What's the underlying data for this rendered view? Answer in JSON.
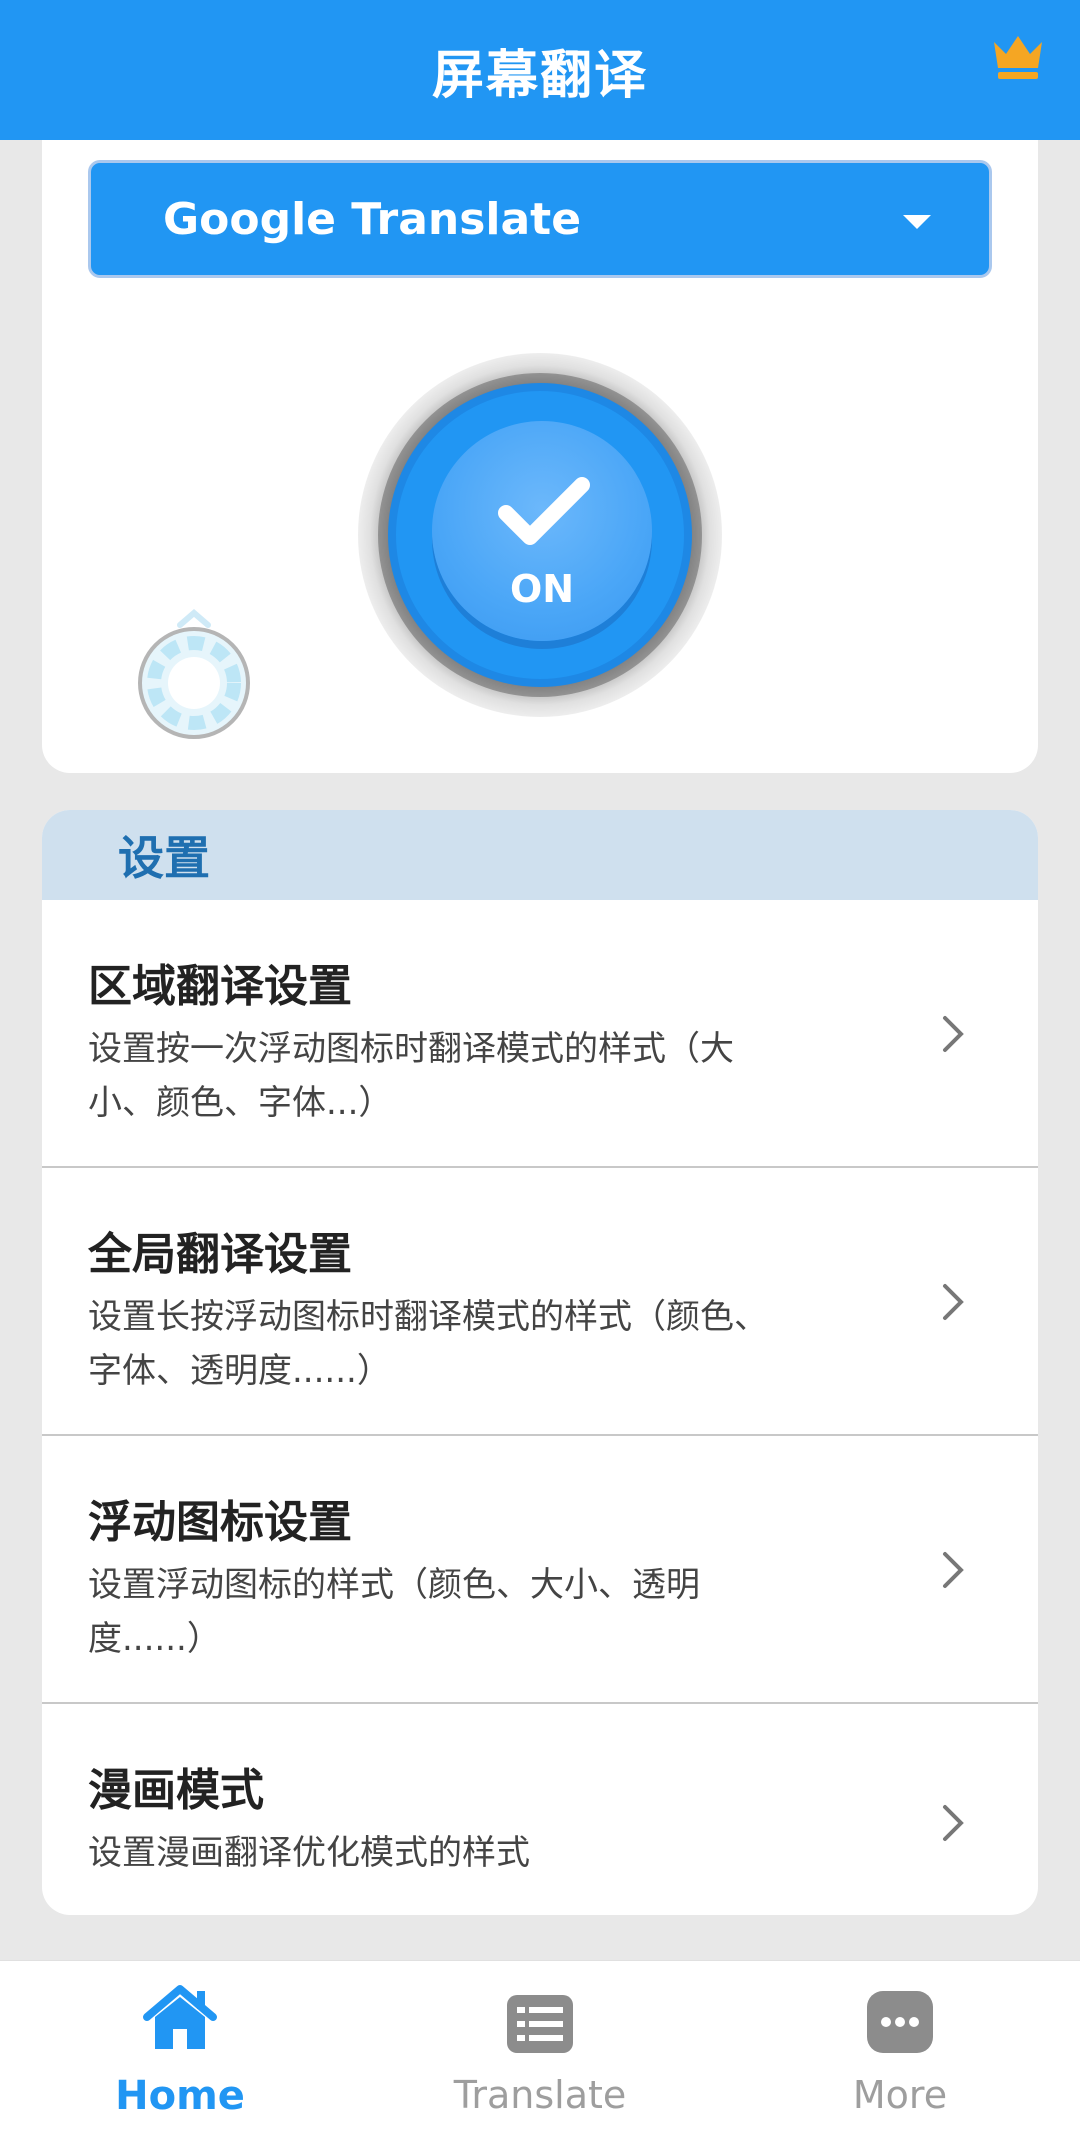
{
  "header": {
    "title": "屏幕翻译",
    "premium_icon": "crown-icon"
  },
  "engine": {
    "selected": "Google Translate"
  },
  "power": {
    "state_label": "ON"
  },
  "settings": {
    "title": "设置",
    "items": [
      {
        "title": "区域翻译设置",
        "desc_line1": "设置按一次浮动图标时翻译模式的样式（大",
        "desc_line2": "小、颜色、字体...）"
      },
      {
        "title": "全局翻译设置",
        "desc_line1": "设置长按浮动图标时翻译模式的样式（颜色、",
        "desc_line2": "字体、透明度......）"
      },
      {
        "title": "浮动图标设置",
        "desc_line1": "设置浮动图标的样式（颜色、大小、透明",
        "desc_line2": "度......）"
      },
      {
        "title": "漫画模式",
        "desc_line1": "设置漫画翻译优化模式的样式",
        "desc_line2": ""
      }
    ]
  },
  "nav": {
    "home": "Home",
    "translate": "Translate",
    "more": "More"
  },
  "colors": {
    "primary": "#2196f3",
    "crown": "#f5a623",
    "settings_header_bg": "#cfe0ee"
  }
}
